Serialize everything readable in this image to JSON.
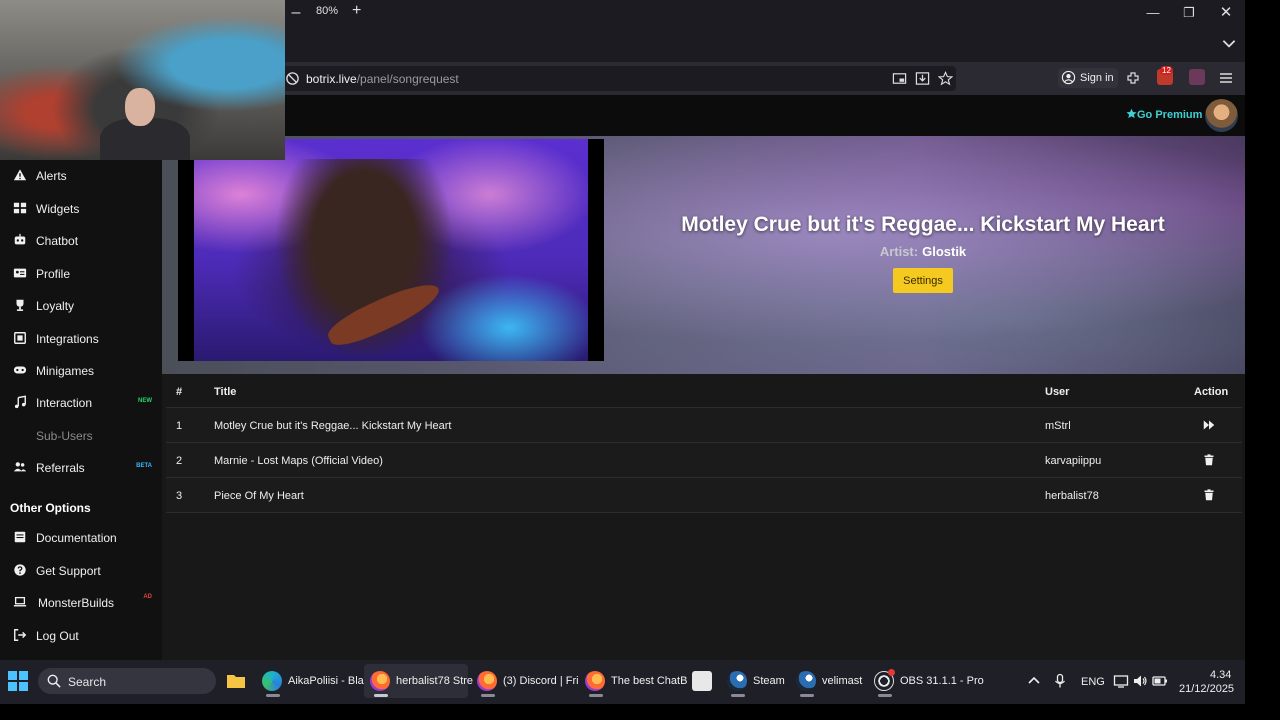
{
  "browser": {
    "zoom_level": "80%",
    "url_host": "botrix.live",
    "url_path": "/panel/songrequest",
    "sign_in_label": "Sign in",
    "notification_count": "12"
  },
  "header": {
    "premium_label": "Go Premium"
  },
  "sidebar": {
    "items": [
      {
        "label": "Alerts",
        "icon": "warning-icon"
      },
      {
        "label": "Widgets",
        "icon": "widgets-icon"
      },
      {
        "label": "Chatbot",
        "icon": "robot-icon"
      },
      {
        "label": "Profile",
        "icon": "profile-card-icon"
      },
      {
        "label": "Loyalty",
        "icon": "trophy-icon"
      },
      {
        "label": "Integrations",
        "icon": "integrations-icon"
      },
      {
        "label": "Minigames",
        "icon": "gamepad-icon"
      },
      {
        "label": "Interaction",
        "icon": "music-icon",
        "badge": "NEW"
      },
      {
        "label": "Sub-Users",
        "icon": "sub-users-icon",
        "disabled": true
      },
      {
        "label": "Referrals",
        "icon": "users-icon",
        "badge": "BETA"
      }
    ],
    "other_heading": "Other Options",
    "other_items": [
      {
        "label": "Documentation",
        "icon": "book-icon"
      },
      {
        "label": "Get Support",
        "icon": "help-icon"
      },
      {
        "label": "MonsterBuilds",
        "icon": "laptop-icon",
        "badge": "AD"
      },
      {
        "label": "Log Out",
        "icon": "logout-icon"
      }
    ]
  },
  "now_playing": {
    "title": "Motley Crue but it's Reggae... Kickstart My Heart",
    "artist_label": "Artist:",
    "artist": "Glostik",
    "settings_label": "Settings"
  },
  "queue": {
    "columns": [
      "#",
      "Title",
      "User",
      "Action"
    ],
    "rows": [
      {
        "num": "1",
        "title": "Motley Crue but it's Reggae... Kickstart My Heart",
        "user": "mStrl",
        "action": "skip-icon"
      },
      {
        "num": "2",
        "title": "Marnie - Lost Maps (Official Video)",
        "user": "karvapiippu",
        "action": "trash-icon"
      },
      {
        "num": "3",
        "title": "Piece Of My Heart",
        "user": "herbalist78",
        "action": "trash-icon"
      }
    ]
  },
  "taskbar": {
    "search_label": "Search",
    "apps": [
      {
        "label": "AikaPoliisi - Bla",
        "icon": "edge-icon"
      },
      {
        "label": "herbalist78 Stre",
        "icon": "firefox-icon"
      },
      {
        "label": "(3) Discord | Fri",
        "icon": "firefox-icon"
      },
      {
        "label": "The best ChatB",
        "icon": "firefox-icon"
      },
      {
        "label": "Steam",
        "icon": "steam-icon"
      },
      {
        "label": "velimast",
        "icon": "steam-icon"
      },
      {
        "label": "OBS 31.1.1 - Pro",
        "icon": "obs-icon"
      }
    ],
    "language": "ENG",
    "time": "4.34",
    "date": "21/12/2025"
  },
  "colors": {
    "accent_premium": "#3fd0d4",
    "settings_button": "#f4c920",
    "badge_new": "#29d36a",
    "badge_beta": "#39b8ff",
    "badge_ad": "#e0443e"
  }
}
